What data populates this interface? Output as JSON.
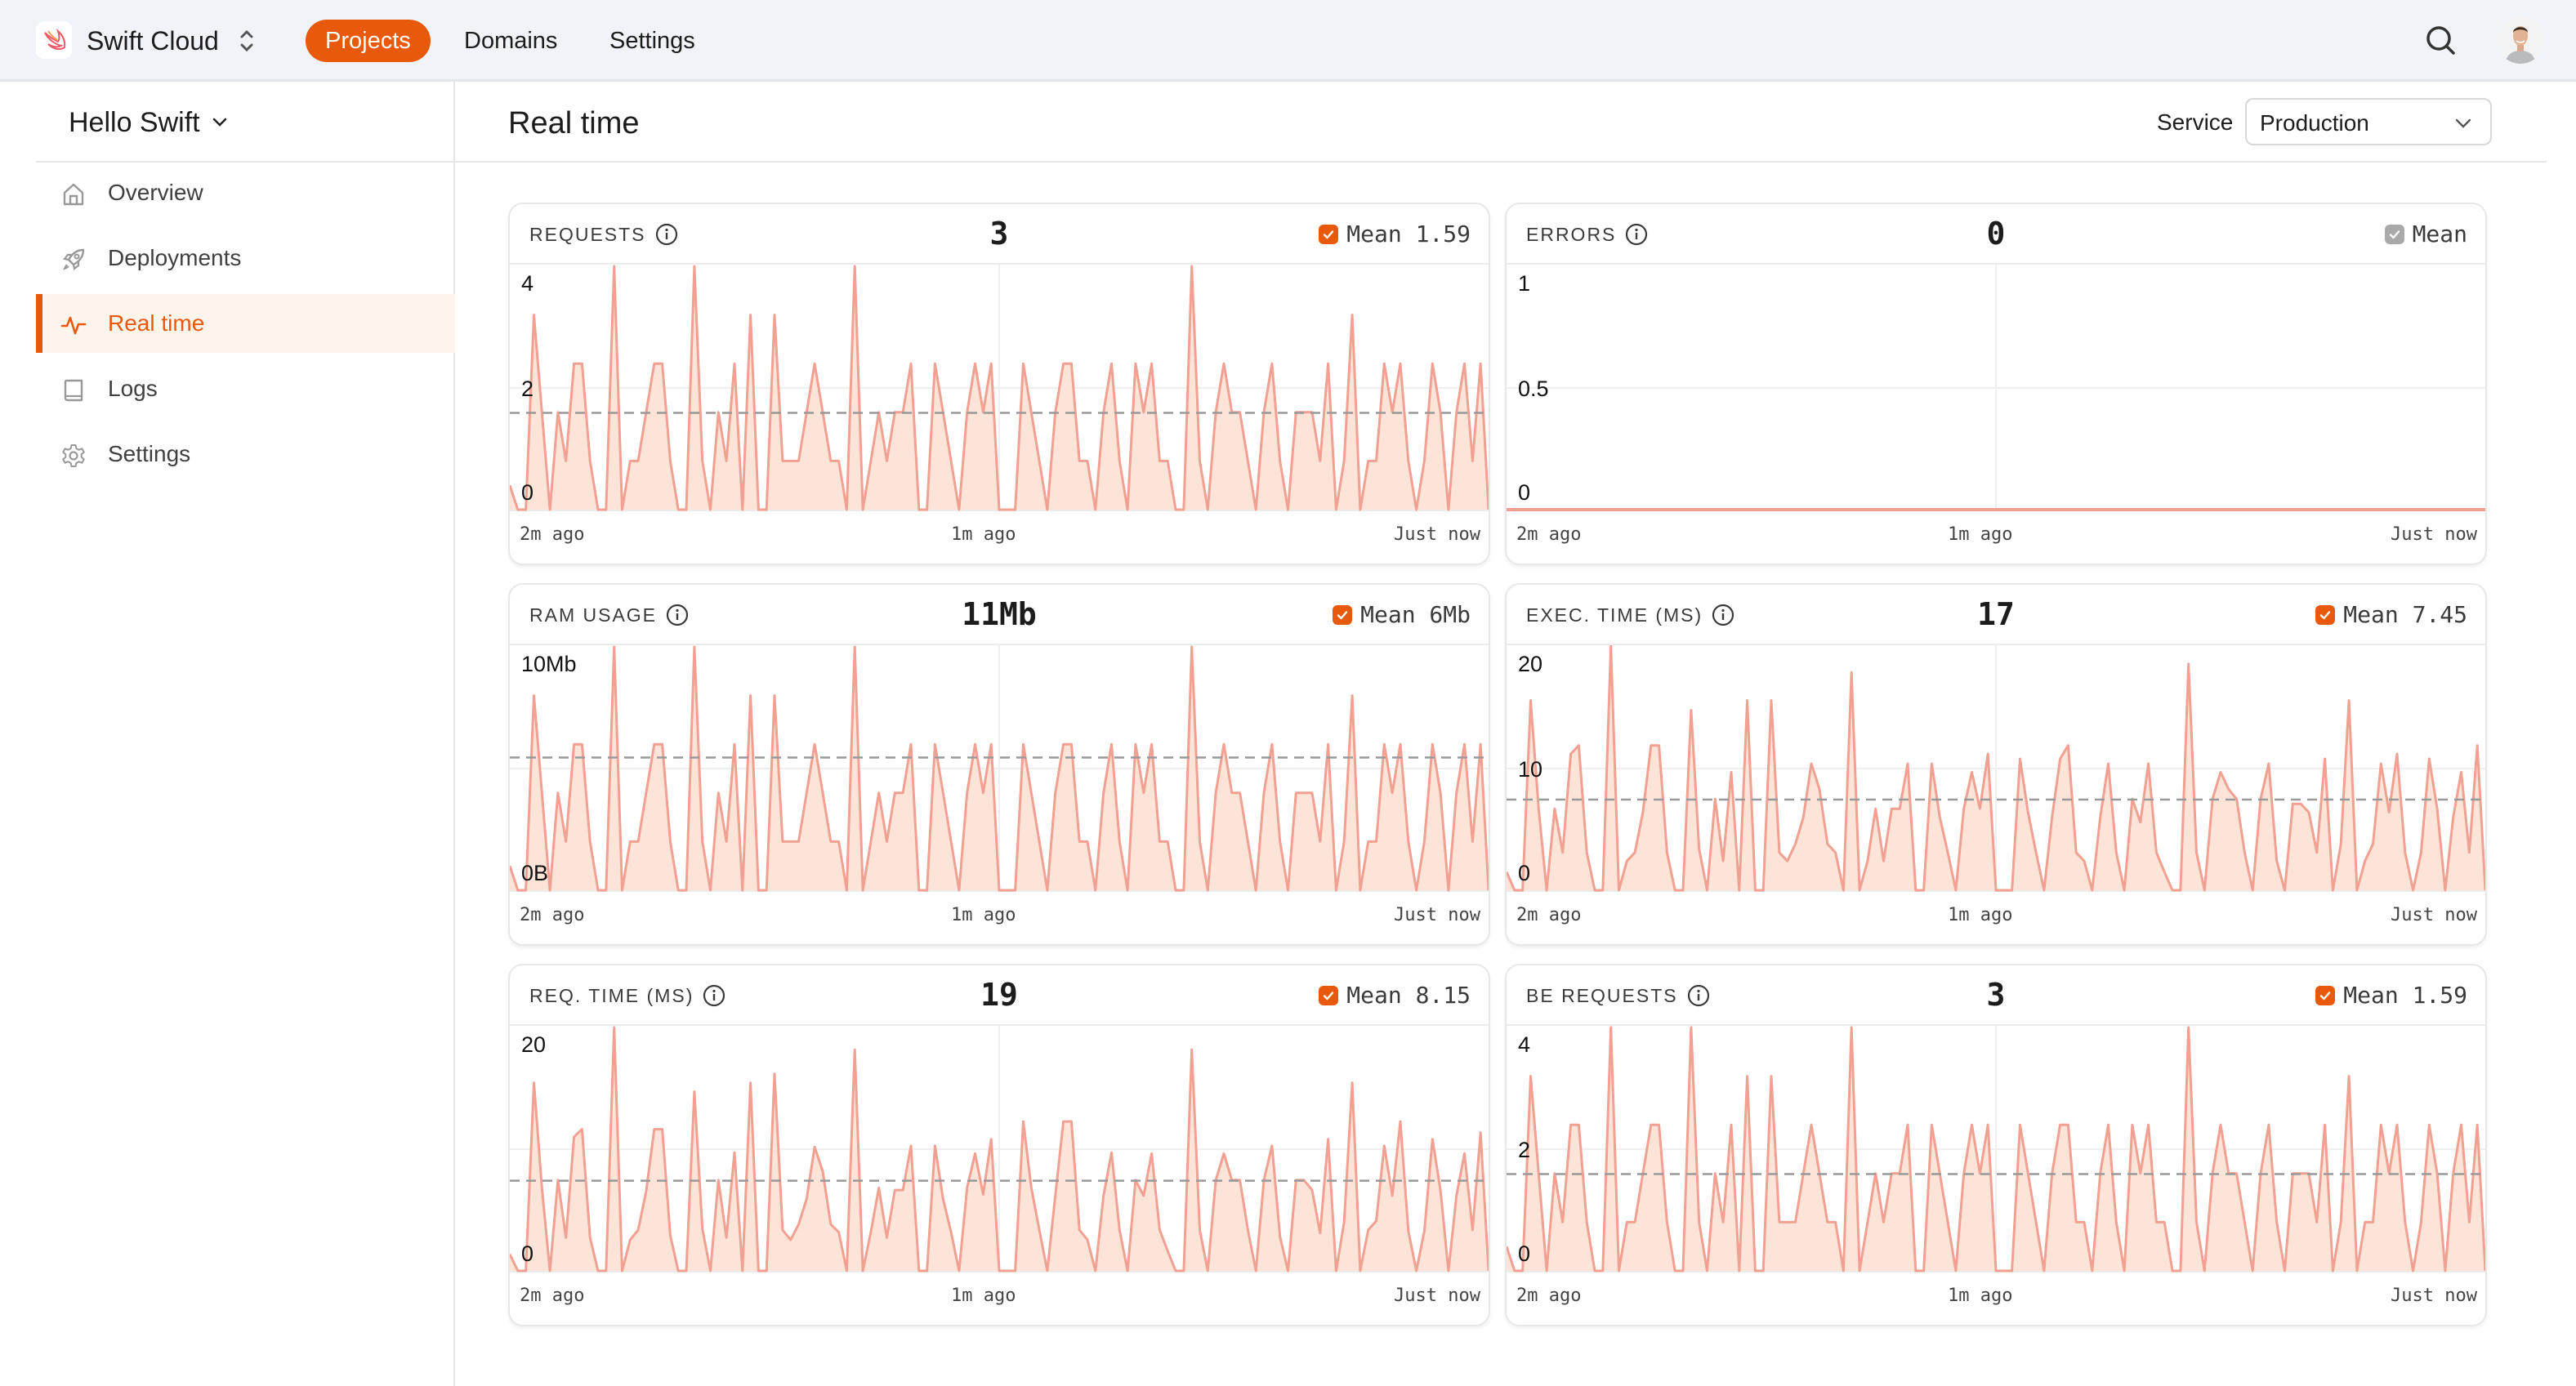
{
  "topbar": {
    "brand": "Swift Cloud",
    "nav": [
      {
        "label": "Projects",
        "active": true
      },
      {
        "label": "Domains",
        "active": false
      },
      {
        "label": "Settings",
        "active": false
      }
    ],
    "icons": {
      "logo": "swift-bird-logo",
      "switcher": "chevron-up-down-icon",
      "search": "search-icon",
      "avatar": "user-avatar"
    }
  },
  "sidebar": {
    "project": "Hello Swift",
    "items": [
      {
        "label": "Overview",
        "icon": "home-icon",
        "active": false
      },
      {
        "label": "Deployments",
        "icon": "rocket-icon",
        "active": false
      },
      {
        "label": "Real time",
        "icon": "activity-icon",
        "active": true
      },
      {
        "label": "Logs",
        "icon": "book-icon",
        "active": false
      },
      {
        "label": "Settings",
        "icon": "gear-icon",
        "active": false
      }
    ]
  },
  "main": {
    "title": "Real time",
    "service_label": "Service",
    "service_value": "Production"
  },
  "colors": {
    "accent": "#e8590c",
    "line": "#f2a091",
    "fill": "#fde4d8",
    "mean_line": "#999999",
    "active_bg": "#fdf5ec",
    "topbar_bg": "#f0f4f8"
  },
  "chart_data": [
    {
      "type": "area",
      "title": "REQUESTS",
      "current": "3",
      "mean_label": "Mean",
      "mean_value": "1.59",
      "mean": 1.59,
      "mean_enabled": true,
      "x_labels": [
        "2m ago",
        "1m ago",
        "Just now"
      ],
      "y_ticks": [
        {
          "v": 4,
          "label": "4"
        },
        {
          "v": 2,
          "label": "2"
        },
        {
          "v": 0,
          "label": "0"
        }
      ],
      "ylim": [
        0,
        4
      ],
      "grid": true,
      "values": [
        0.4,
        0,
        0,
        3.2,
        1.6,
        0,
        1.6,
        0.8,
        2.4,
        2.4,
        0.8,
        0,
        0,
        4,
        0,
        0.8,
        0.8,
        1.6,
        2.4,
        2.4,
        0.8,
        0,
        0,
        4,
        0.8,
        0,
        1.6,
        0.8,
        2.4,
        0,
        3.2,
        0,
        0,
        3.2,
        0.8,
        0.8,
        0.8,
        1.6,
        2.4,
        1.6,
        0.8,
        0.8,
        0,
        4,
        0,
        0.8,
        1.6,
        0.8,
        1.6,
        1.6,
        2.4,
        0,
        0,
        2.4,
        1.6,
        0.8,
        0,
        1.6,
        2.4,
        1.6,
        2.4,
        0,
        0,
        0,
        2.4,
        1.6,
        0.8,
        0,
        1.6,
        2.4,
        2.4,
        0.8,
        0.8,
        0,
        1.6,
        2.4,
        0.8,
        0,
        2.4,
        1.6,
        2.4,
        0.8,
        0.8,
        0,
        0,
        4,
        0.8,
        0,
        1.6,
        2.4,
        1.6,
        1.6,
        0.8,
        0,
        1.6,
        2.4,
        0.8,
        0,
        1.6,
        1.6,
        1.6,
        0.8,
        2.4,
        0,
        0.8,
        3.2,
        0,
        0.8,
        0.8,
        2.4,
        1.6,
        2.4,
        0.8,
        0,
        0.8,
        2.4,
        1.6,
        0,
        1.6,
        2.4,
        0.8,
        2.4,
        0
      ]
    },
    {
      "type": "line",
      "title": "ERRORS",
      "current": "0",
      "mean_label": "Mean",
      "mean_value": "",
      "mean": null,
      "mean_enabled": false,
      "x_labels": [
        "2m ago",
        "1m ago",
        "Just now"
      ],
      "y_ticks": [
        {
          "v": 1,
          "label": "1"
        },
        {
          "v": 0.5,
          "label": "0.5"
        },
        {
          "v": 0,
          "label": "0"
        }
      ],
      "ylim": [
        0,
        1
      ],
      "grid": true,
      "values": [
        0,
        0
      ]
    },
    {
      "type": "area",
      "title": "RAM USAGE",
      "current": "11Mb",
      "mean_label": "Mean",
      "mean_value": "6Mb",
      "mean": 6,
      "mean_enabled": true,
      "x_labels": [
        "2m ago",
        "1m ago",
        "Just now"
      ],
      "y_ticks": [
        {
          "v": 10,
          "label": "10Mb"
        },
        {
          "v": 5.5,
          "label": ""
        },
        {
          "v": 0,
          "label": "0B"
        }
      ],
      "ylim": [
        0,
        11
      ],
      "grid": true,
      "values": [
        1.1,
        0,
        0,
        8.8,
        4.4,
        0,
        4.4,
        2.2,
        6.6,
        6.6,
        2.2,
        0,
        0,
        11,
        0,
        2.2,
        2.2,
        4.4,
        6.6,
        6.6,
        2.2,
        0,
        0,
        11,
        2.2,
        0,
        4.4,
        2.2,
        6.6,
        0,
        8.8,
        0,
        0,
        8.8,
        2.2,
        2.2,
        2.2,
        4.4,
        6.6,
        4.4,
        2.2,
        2.2,
        0,
        11,
        0,
        2.2,
        4.4,
        2.2,
        4.4,
        4.4,
        6.6,
        0,
        0,
        6.6,
        4.4,
        2.2,
        0,
        4.4,
        6.6,
        4.4,
        6.6,
        0,
        0,
        0,
        6.6,
        4.4,
        2.2,
        0,
        4.4,
        6.6,
        6.6,
        2.2,
        2.2,
        0,
        4.4,
        6.6,
        2.2,
        0,
        6.6,
        4.4,
        6.6,
        2.2,
        2.2,
        0,
        0,
        11,
        2.2,
        0,
        4.4,
        6.6,
        4.4,
        4.4,
        2.2,
        0,
        4.4,
        6.6,
        2.2,
        0,
        4.4,
        4.4,
        4.4,
        2.2,
        6.6,
        0,
        2.2,
        8.8,
        0,
        2.2,
        2.2,
        6.6,
        4.4,
        6.6,
        2.2,
        0,
        2.2,
        6.6,
        4.4,
        0,
        4.4,
        6.6,
        2.2,
        6.6,
        0
      ]
    },
    {
      "type": "area",
      "title": "EXEC. TIME (MS)",
      "current": "17",
      "mean_label": "Mean",
      "mean_value": "7.45",
      "mean": 7.45,
      "mean_enabled": true,
      "x_labels": [
        "2m ago",
        "1m ago",
        "Just now"
      ],
      "y_ticks": [
        {
          "v": 20,
          "label": "20"
        },
        {
          "v": 10,
          "label": "10"
        },
        {
          "v": 0,
          "label": "0"
        }
      ],
      "ylim": [
        0,
        20
      ],
      "grid": true,
      "values": [
        1.5,
        0,
        0,
        15.6,
        6.7,
        0,
        6.7,
        3.1,
        11.2,
        11.9,
        3.1,
        0,
        0,
        20.1,
        0,
        2.4,
        3.1,
        6.4,
        11.9,
        11.9,
        3.1,
        0,
        0,
        14.8,
        3.4,
        0,
        7.5,
        2.4,
        9.7,
        0,
        15.6,
        0,
        0,
        15.6,
        3.1,
        2.4,
        3.8,
        6.0,
        10.4,
        8.3,
        3.8,
        3.1,
        0,
        17.9,
        0,
        2.4,
        6.7,
        2.4,
        6.7,
        6.7,
        10.4,
        0,
        0,
        10.4,
        6.0,
        3.1,
        0,
        6.7,
        9.7,
        6.7,
        11.2,
        0,
        0,
        0,
        10.8,
        6.4,
        3.1,
        0,
        6.0,
        10.8,
        11.9,
        3.1,
        2.4,
        0,
        6.0,
        10.4,
        3.1,
        0,
        7.5,
        5.6,
        10.4,
        3.1,
        1.5,
        0,
        0,
        18.6,
        3.1,
        0,
        7.5,
        9.7,
        8.3,
        7.5,
        3.1,
        0,
        7.5,
        10.4,
        2.4,
        0,
        7.1,
        7.1,
        6.4,
        3.1,
        10.8,
        0,
        3.8,
        15.6,
        0,
        2.4,
        3.8,
        10.4,
        6.4,
        11.2,
        3.1,
        0,
        3.1,
        10.8,
        6.7,
        0,
        6.0,
        9.7,
        3.1,
        11.9,
        0
      ]
    },
    {
      "type": "area",
      "title": "REQ. TIME (MS)",
      "current": "19",
      "mean_label": "Mean",
      "mean_value": "8.15",
      "mean": 8.15,
      "mean_enabled": true,
      "x_labels": [
        "2m ago",
        "1m ago",
        "Just now"
      ],
      "y_ticks": [
        {
          "v": 20,
          "label": "20"
        },
        {
          "v": 10,
          "label": ""
        },
        {
          "v": 0,
          "label": "0"
        }
      ],
      "ylim": [
        0,
        22
      ],
      "grid": true,
      "values": [
        1.5,
        0,
        0,
        17.0,
        7.5,
        0,
        8.2,
        3.0,
        12.1,
        12.8,
        3.0,
        0,
        0,
        22.0,
        0,
        2.8,
        3.7,
        7.2,
        12.8,
        12.8,
        3.2,
        0,
        0,
        16.2,
        3.8,
        0,
        8.2,
        3.0,
        10.7,
        0,
        17.0,
        0,
        0,
        17.8,
        3.7,
        2.8,
        4.2,
        6.5,
        11.2,
        9.0,
        4.2,
        3.5,
        0,
        20.0,
        0,
        3.5,
        7.5,
        3.0,
        7.3,
        7.3,
        11.3,
        0,
        0,
        11.3,
        6.5,
        3.5,
        0,
        7.5,
        10.6,
        6.9,
        11.9,
        0,
        0,
        0,
        13.5,
        7.5,
        3.7,
        0,
        6.8,
        13.5,
        13.5,
        3.7,
        2.8,
        0,
        6.8,
        10.7,
        3.7,
        0,
        8.2,
        6.8,
        10.6,
        3.7,
        1.8,
        0,
        0,
        20.0,
        3.7,
        0,
        8.2,
        10.6,
        8.2,
        8.2,
        3.7,
        0,
        8.2,
        11.3,
        3.1,
        0,
        8.2,
        8.2,
        7.3,
        3.4,
        11.9,
        0,
        4.4,
        17.0,
        0,
        3.7,
        4.5,
        11.3,
        6.8,
        13.5,
        3.6,
        0,
        3.6,
        11.9,
        7.3,
        0,
        6.8,
        10.6,
        3.7,
        12.5,
        0
      ]
    },
    {
      "type": "area",
      "title": "BE REQUESTS",
      "current": "3",
      "mean_label": "Mean",
      "mean_value": "1.59",
      "mean": 1.59,
      "mean_enabled": true,
      "x_labels": [
        "2m ago",
        "1m ago",
        "Just now"
      ],
      "y_ticks": [
        {
          "v": 4,
          "label": "4"
        },
        {
          "v": 2,
          "label": "2"
        },
        {
          "v": 0,
          "label": "0"
        }
      ],
      "ylim": [
        0,
        4
      ],
      "grid": true,
      "values": [
        0.4,
        0,
        0,
        3.2,
        1.6,
        0,
        1.6,
        0.8,
        2.4,
        2.4,
        0.8,
        0,
        0,
        4,
        0,
        0.8,
        0.8,
        1.6,
        2.4,
        2.4,
        0.8,
        0,
        0,
        4,
        0.8,
        0,
        1.6,
        0.8,
        2.4,
        0,
        3.2,
        0,
        0,
        3.2,
        0.8,
        0.8,
        0.8,
        1.6,
        2.4,
        1.6,
        0.8,
        0.8,
        0,
        4,
        0,
        0.8,
        1.6,
        0.8,
        1.6,
        1.6,
        2.4,
        0,
        0,
        2.4,
        1.6,
        0.8,
        0,
        1.6,
        2.4,
        1.6,
        2.4,
        0,
        0,
        0,
        2.4,
        1.6,
        0.8,
        0,
        1.6,
        2.4,
        2.4,
        0.8,
        0.8,
        0,
        1.6,
        2.4,
        0.8,
        0,
        2.4,
        1.6,
        2.4,
        0.8,
        0.8,
        0,
        0,
        4,
        0.8,
        0,
        1.6,
        2.4,
        1.6,
        1.6,
        0.8,
        0,
        1.6,
        2.4,
        0.8,
        0,
        1.6,
        1.6,
        1.6,
        0.8,
        2.4,
        0,
        0.8,
        3.2,
        0,
        0.8,
        0.8,
        2.4,
        1.6,
        2.4,
        0.8,
        0,
        0.8,
        2.4,
        1.6,
        0,
        1.6,
        2.4,
        0.8,
        2.4,
        0
      ]
    }
  ]
}
